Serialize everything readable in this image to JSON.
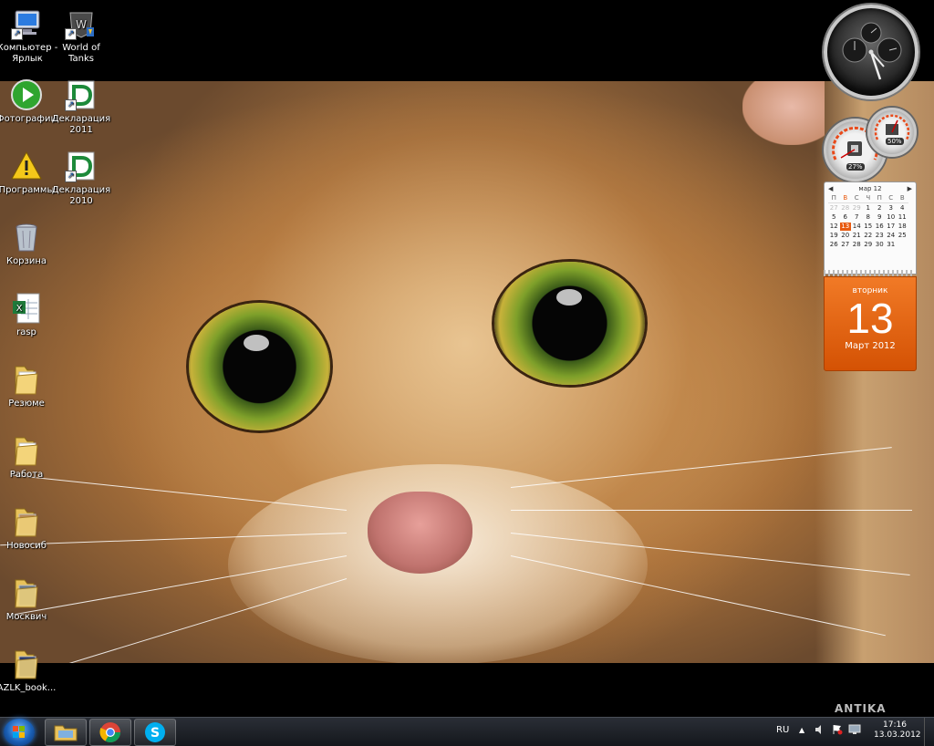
{
  "desktop": {
    "icons": [
      {
        "label": "Компьютер - Ярлык",
        "icon": "computer-icon"
      },
      {
        "label": "World of Tanks",
        "icon": "world-of-tanks-icon"
      },
      {
        "label": "Фотографии",
        "icon": "play-icon"
      },
      {
        "label": "Декларация 2011",
        "icon": "declaration-icon"
      },
      {
        "label": "Программы",
        "icon": "warning-icon"
      },
      {
        "label": "Декларация 2010",
        "icon": "declaration-icon"
      },
      {
        "label": "Корзина",
        "icon": "recycle-bin-icon"
      },
      {
        "label": "rasp",
        "icon": "excel-file-icon"
      },
      {
        "label": "Резюме",
        "icon": "folder-icon"
      },
      {
        "label": "Работа",
        "icon": "folder-icon"
      },
      {
        "label": "Новосиб",
        "icon": "folder-icon"
      },
      {
        "label": "Москвич",
        "icon": "folder-icon"
      },
      {
        "label": "AZLK_book...",
        "icon": "folder-icon"
      }
    ]
  },
  "gadgets": {
    "meter": {
      "cpu_percent": "27%",
      "memory_percent": "50%"
    },
    "calendar": {
      "month_header": "мар 12",
      "weekdays": [
        "П",
        "В",
        "С",
        "Ч",
        "П",
        "С",
        "В"
      ],
      "weeks": [
        [
          "27",
          "28",
          "29",
          "1",
          "2",
          "3",
          "4"
        ],
        [
          "5",
          "6",
          "7",
          "8",
          "9",
          "10",
          "11"
        ],
        [
          "12",
          "13",
          "14",
          "15",
          "16",
          "17",
          "18"
        ],
        [
          "19",
          "20",
          "21",
          "22",
          "23",
          "24",
          "25"
        ],
        [
          "26",
          "27",
          "28",
          "29",
          "30",
          "31",
          ""
        ]
      ],
      "weekday": "вторник",
      "day": "13",
      "month_year": "Март 2012"
    }
  },
  "taskbar": {
    "pinned": [
      "explorer-icon",
      "chrome-icon",
      "skype-icon"
    ],
    "language": "RU",
    "time": "17:16",
    "date": "13.03.2012"
  },
  "watermark": "ANTIKA",
  "colors": {
    "accent_orange": "#e85a10",
    "taskbar": "#1b1e24"
  }
}
